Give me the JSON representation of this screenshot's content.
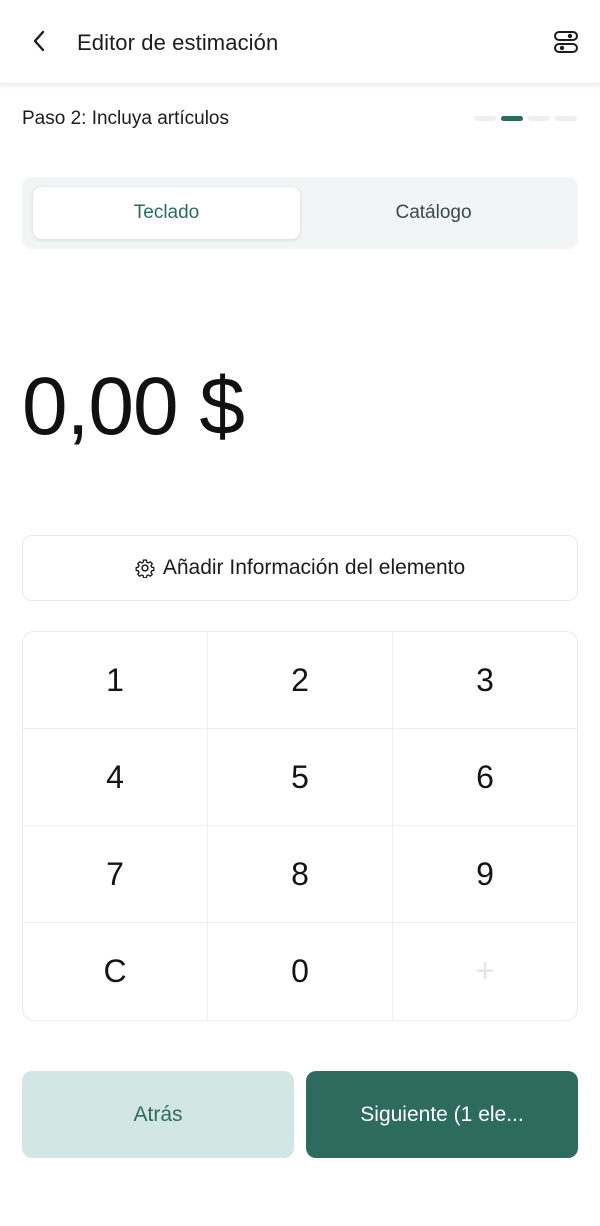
{
  "header": {
    "title": "Editor de estimación",
    "back_icon": "chevron-left-icon",
    "settings_icon": "toggle-settings-icon"
  },
  "step": {
    "label": "Paso 2: Incluya artículos",
    "total": 4,
    "current": 2
  },
  "tabs": [
    {
      "label": "Teclado",
      "selected": true
    },
    {
      "label": "Catálogo",
      "selected": false
    }
  ],
  "amount": "0,00 $",
  "add_info": {
    "label": "Añadir Información del elemento",
    "icon": "gear-icon"
  },
  "keypad": {
    "keys": [
      "1",
      "2",
      "3",
      "4",
      "5",
      "6",
      "7",
      "8",
      "9",
      "C",
      "0",
      "+"
    ]
  },
  "footer": {
    "back_label": "Atrás",
    "next_label": "Siguiente (1 ele..."
  },
  "colors": {
    "accent": "#2e6b5f",
    "accent_light": "#d2e6e4",
    "segment_bg": "#f2f5f5"
  }
}
